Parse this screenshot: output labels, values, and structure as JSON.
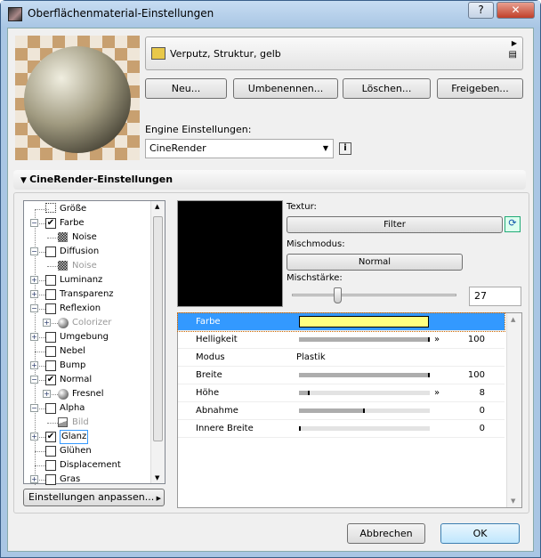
{
  "window": {
    "title": "Oberflächenmaterial-Einstellungen",
    "help_label": "?",
    "close_label": "✕"
  },
  "material": {
    "name": "Verputz, Struktur, gelb",
    "swatch_color": "#e8c84a"
  },
  "buttons": {
    "new": "Neu...",
    "rename": "Umbenennen...",
    "delete": "Löschen...",
    "share": "Freigeben..."
  },
  "engine": {
    "label": "Engine Einstellungen:",
    "value": "CineRender",
    "info": "i"
  },
  "section": {
    "title": "CineRender-Einstellungen"
  },
  "tree": {
    "items": [
      {
        "label": "Größe",
        "level": 0,
        "expander": "",
        "checked": null,
        "icon": "size",
        "disabled": false
      },
      {
        "label": "Farbe",
        "level": 0,
        "expander": "−",
        "checked": true,
        "disabled": false
      },
      {
        "label": "Noise",
        "level": 1,
        "expander": "",
        "icon": "noise",
        "disabled": false
      },
      {
        "label": "Diffusion",
        "level": 0,
        "expander": "−",
        "checked": false,
        "disabled": false
      },
      {
        "label": "Noise",
        "level": 1,
        "expander": "",
        "icon": "noise",
        "disabled": true
      },
      {
        "label": "Luminanz",
        "level": 0,
        "expander": "+",
        "checked": false,
        "disabled": false
      },
      {
        "label": "Transparenz",
        "level": 0,
        "expander": "+",
        "checked": false,
        "disabled": false
      },
      {
        "label": "Reflexion",
        "level": 0,
        "expander": "−",
        "checked": false,
        "disabled": false
      },
      {
        "label": "Colorizer",
        "level": 1,
        "expander": "+",
        "icon": "sphere",
        "disabled": true
      },
      {
        "label": "Umgebung",
        "level": 0,
        "expander": "+",
        "checked": false,
        "disabled": false
      },
      {
        "label": "Nebel",
        "level": 0,
        "expander": "",
        "checked": false,
        "disabled": false
      },
      {
        "label": "Bump",
        "level": 0,
        "expander": "+",
        "checked": false,
        "disabled": false
      },
      {
        "label": "Normal",
        "level": 0,
        "expander": "−",
        "checked": true,
        "disabled": false
      },
      {
        "label": "Fresnel",
        "level": 1,
        "expander": "+",
        "icon": "sphere",
        "disabled": false
      },
      {
        "label": "Alpha",
        "level": 0,
        "expander": "−",
        "checked": false,
        "disabled": false
      },
      {
        "label": "Bild",
        "level": 1,
        "expander": "",
        "icon": "image",
        "disabled": true
      },
      {
        "label": "Glanz",
        "level": 0,
        "expander": "+",
        "checked": true,
        "disabled": false,
        "focused": true
      },
      {
        "label": "Glühen",
        "level": 0,
        "expander": "",
        "checked": false,
        "disabled": false
      },
      {
        "label": "Displacement",
        "level": 0,
        "expander": "",
        "checked": false,
        "disabled": false
      },
      {
        "label": "Gras",
        "level": 0,
        "expander": "+",
        "checked": false,
        "disabled": false
      }
    ]
  },
  "customize_button": "Einstellungen anpassen...",
  "texture": {
    "label": "Textur:",
    "filter_button": "Filter",
    "blend_mode_label": "Mischmodus:",
    "blend_mode": "Normal",
    "strength_label": "Mischstärke:",
    "strength": "27",
    "strength_fraction": 0.27
  },
  "properties": [
    {
      "name": "Farbe",
      "type": "color",
      "color": "#ffff80",
      "selected": true
    },
    {
      "name": "Helligkeit",
      "type": "slider",
      "value": "100",
      "fraction": 1.0,
      "arrow": true
    },
    {
      "name": "Modus",
      "type": "text",
      "value": "Plastik"
    },
    {
      "name": "Breite",
      "type": "slider",
      "value": "100",
      "fraction": 1.0,
      "arrow": false
    },
    {
      "name": "Höhe",
      "type": "slider",
      "value": "8",
      "fraction": 0.08,
      "arrow": true
    },
    {
      "name": "Abnahme",
      "type": "slider",
      "value": "0",
      "fraction": 0.5,
      "arrow": false
    },
    {
      "name": "Innere Breite",
      "type": "slider",
      "value": "0",
      "fraction": 0.0,
      "arrow": false
    }
  ],
  "footer": {
    "cancel": "Abbrechen",
    "ok": "OK"
  }
}
